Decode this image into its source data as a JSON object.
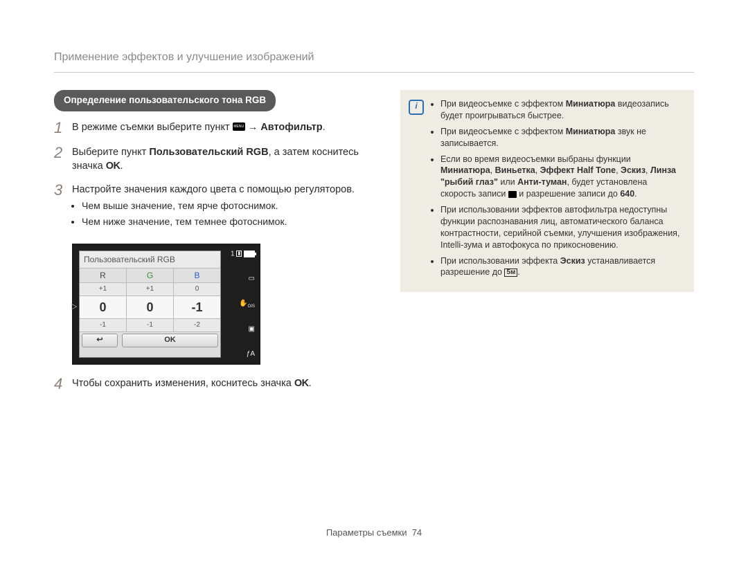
{
  "header": {
    "title": "Применение эффектов и улучшение изображений"
  },
  "pill": {
    "label": "Определение пользовательского тона RGB"
  },
  "steps": [
    {
      "num": "1",
      "pre": "В режиме съемки выберите пункт ",
      "post_arrow": " → ",
      "target": "Автофильтр",
      "tail": "."
    },
    {
      "num": "2",
      "a": "Выберите пункт ",
      "b": "Пользовательский RGB",
      "c": ", а затем коснитесь значка ",
      "ok": "OK",
      "d": "."
    },
    {
      "num": "3",
      "text": "Настройте значения каждого цвета с помощью регуляторов.",
      "bullets": [
        "Чем выше значение, тем ярче фотоснимок.",
        "Чем ниже значение, тем темнее фотоснимок."
      ]
    },
    {
      "num": "4",
      "a": "Чтобы сохранить изменения, коснитесь значка ",
      "ok": "OK",
      "b": "."
    }
  ],
  "lcd": {
    "title": "Пользовательcкий RGB",
    "cols": [
      "R",
      "G",
      "B"
    ],
    "row_up": [
      "+1",
      "+1",
      "0"
    ],
    "row_main": [
      "0",
      "0",
      "-1"
    ],
    "row_down": [
      "-1",
      "-1",
      "-2"
    ],
    "back": "↩",
    "ok": "OK",
    "card_count": "1",
    "flash_label": "ƒA"
  },
  "notes": {
    "items": [
      {
        "a": "При видеосъемке с эффектом ",
        "b": "Миниатюра",
        "c": " видеозапись будет проигрываться быстрее."
      },
      {
        "a": "При видеосъемке с эффектом ",
        "b": "Миниатюра",
        "c": " звук не записывается."
      },
      {
        "a": "Если во время видеосъемки выбраны функции ",
        "b": "Миниатюра",
        "c": ", ",
        "d": "Виньетка",
        "e": ", ",
        "f": "Эффект Half Tone",
        "g": ", ",
        "h": "Эскиз",
        "i": ", ",
        "j": "Линза \"рыбий глаз\"",
        "k": " или ",
        "l": "Анти-туман",
        "m": ", будет установлена скорость записи ",
        "n": " и разрешение записи до ",
        "res": "640",
        "o": "."
      },
      {
        "text": "При использовании эффектов автофильтра недоступны функции распознавания лиц, автоматического баланса контрастности, серийной съемки, улучшения изображения, Intelli-зума и автофокуса по прикосновению."
      },
      {
        "a": "При использовании эффекта ",
        "b": "Эскиз",
        "c": " устанавливается разрешение до ",
        "res": "5ᴍ",
        "d": "."
      }
    ]
  },
  "footer": {
    "section": "Параметры съемки",
    "page": "74"
  }
}
